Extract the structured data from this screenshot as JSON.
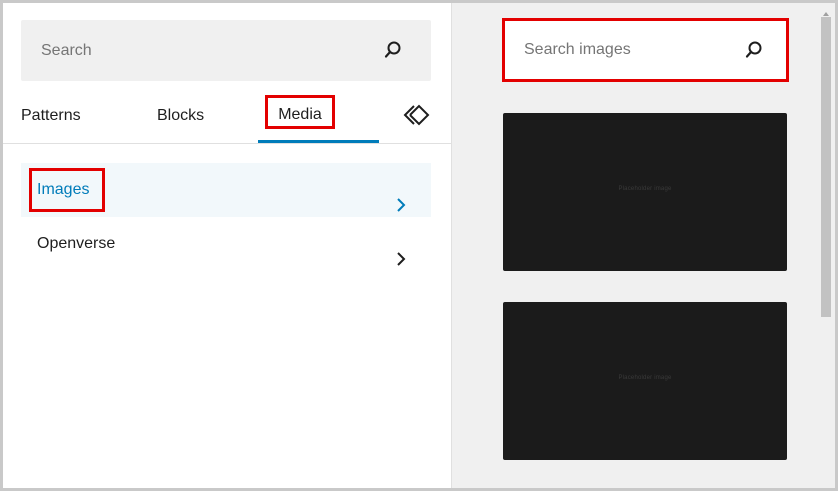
{
  "search": {
    "placeholder": "Search",
    "icon": "search-icon"
  },
  "tabs": {
    "items": [
      {
        "label": "Patterns",
        "selected": false
      },
      {
        "label": "Blocks",
        "selected": false
      },
      {
        "label": "Media",
        "selected": true
      }
    ],
    "close_icon": "close-inserter-icon"
  },
  "media_categories": [
    {
      "label": "Images",
      "selected": true,
      "icon": "chevron-right-icon"
    },
    {
      "label": "Openverse",
      "selected": false,
      "icon": "chevron-right-icon"
    }
  ],
  "image_panel": {
    "search": {
      "placeholder": "Search images",
      "icon": "search-icon"
    },
    "thumbnails": [
      {
        "caption": "Placeholder image"
      },
      {
        "caption": "Placeholder image"
      }
    ]
  },
  "colors": {
    "accent": "#007cba",
    "highlight_outline": "#e30000",
    "thumbnail_bg": "#1b1b1b",
    "panel_bg": "#f0f0f0"
  }
}
